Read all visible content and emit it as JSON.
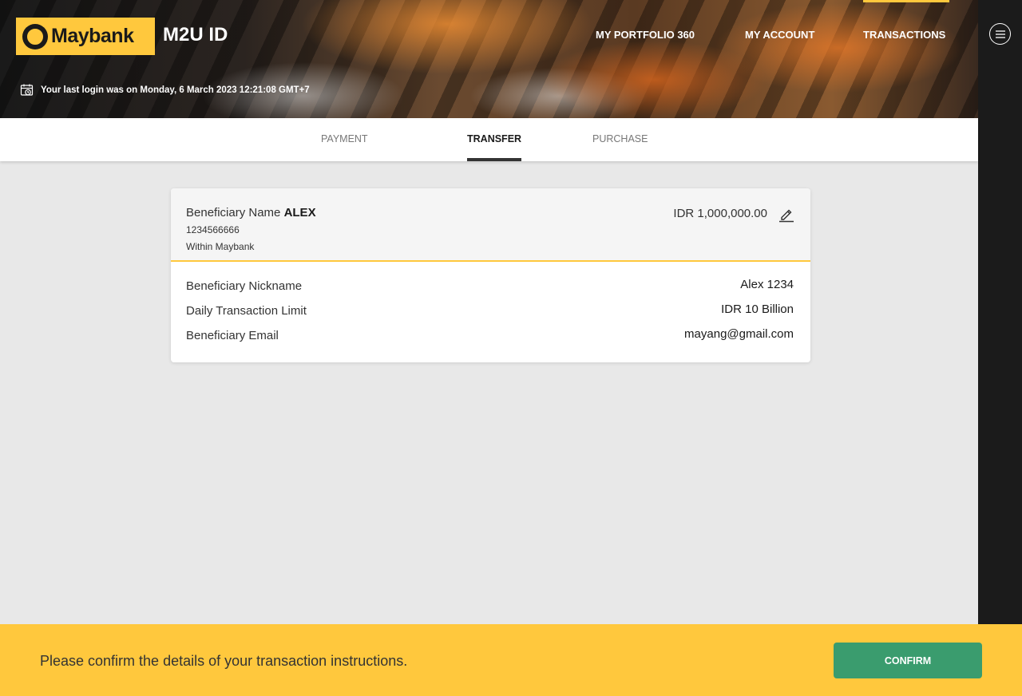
{
  "header": {
    "logo_text": "Maybank",
    "app_title": "M2U ID",
    "nav": {
      "portfolio": "MY PORTFOLIO 360",
      "account": "MY ACCOUNT",
      "transactions": "TRANSACTIONS"
    },
    "last_login": "Your last login was on Monday, 6 March 2023 12:21:08 GMT+7"
  },
  "tabs": {
    "payment": "PAYMENT",
    "transfer": "TRANSFER",
    "purchase": "PURCHASE",
    "active": "transfer"
  },
  "card": {
    "beneficiary_label": "Beneficiary Name",
    "beneficiary_name": "ALEX",
    "account_number": "1234566666",
    "bank": "Within Maybank",
    "amount": "IDR 1,000,000.00",
    "rows": [
      {
        "label": "Beneficiary Nickname",
        "value": "Alex 1234"
      },
      {
        "label": "Daily Transaction Limit",
        "value": "IDR 10 Billion"
      },
      {
        "label": "Beneficiary Email",
        "value": "mayang@gmail.com"
      }
    ]
  },
  "footer": {
    "message": "Please confirm the details of your transaction instructions.",
    "confirm_label": "CONFIRM"
  },
  "colors": {
    "brand_yellow": "#ffc83d",
    "confirm_green": "#3a9c6e",
    "rail_dark": "#1b1b1b"
  },
  "icons": {
    "calendar": "calendar-clock-icon",
    "menu": "hamburger-menu-icon",
    "edit": "pencil-edit-icon",
    "logo": "tiger-logo-icon"
  }
}
